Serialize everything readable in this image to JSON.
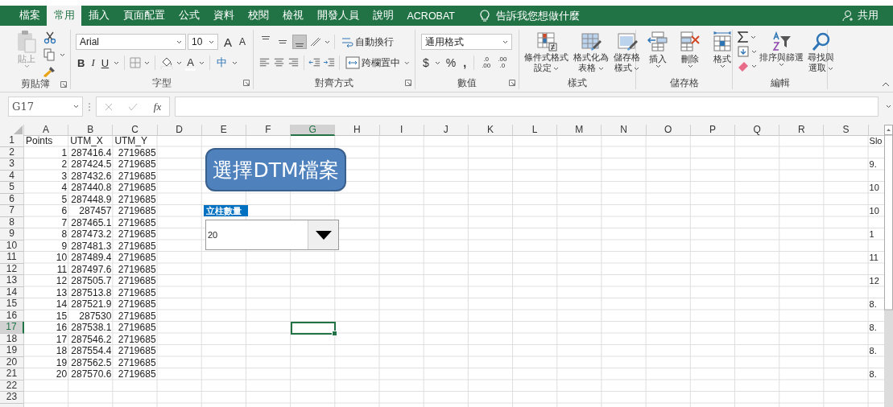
{
  "tabs": [
    {
      "label": "檔案",
      "selected": false
    },
    {
      "label": "常用",
      "selected": true
    },
    {
      "label": "插入",
      "selected": false
    },
    {
      "label": "頁面配置",
      "selected": false
    },
    {
      "label": "公式",
      "selected": false
    },
    {
      "label": "資料",
      "selected": false
    },
    {
      "label": "校閱",
      "selected": false
    },
    {
      "label": "檢視",
      "selected": false
    },
    {
      "label": "開發人員",
      "selected": false
    },
    {
      "label": "說明",
      "selected": false
    },
    {
      "label": "ACROBAT",
      "selected": false
    }
  ],
  "tell_me": {
    "placeholder": "告訴我您想做什麼"
  },
  "share": "共用",
  "clipboard": {
    "paste": {
      "label": "貼上",
      "disabled": true
    },
    "group_label": "剪貼簿"
  },
  "font": {
    "name": "Arial",
    "size": "10",
    "grow": "A",
    "shrink": "A",
    "bold": "B",
    "italic": "I",
    "underline": "U",
    "color_button": "A",
    "phonetic": "中",
    "group_label": "字型"
  },
  "alignment": {
    "vertical": [
      {
        "selected": false
      },
      {
        "selected": false
      },
      {
        "selected": true
      }
    ],
    "wrap": "自動換行",
    "merge": "跨欄置中",
    "group_label": "對齊方式"
  },
  "number": {
    "format": "通用格式",
    "currency": "$",
    "percent": "%",
    "comma": ",",
    "decimals": [
      {
        "top": ".0",
        "bottom": ".00"
      },
      {
        "top": ".00",
        "bottom": ".0"
      }
    ],
    "group_label": "數值"
  },
  "styles": {
    "buttons": [
      {
        "lines": [
          "條件式格式",
          "設定"
        ]
      },
      {
        "lines": [
          "格式化為",
          "表格"
        ]
      },
      {
        "lines": [
          "儲存格",
          "樣式"
        ]
      }
    ],
    "group_label": "樣式"
  },
  "cells": {
    "buttons": [
      "插入",
      "刪除",
      "格式"
    ],
    "group_label": "儲存格"
  },
  "editing": {
    "sort": "排序與篩選",
    "find": [
      "尋找與",
      "選取"
    ],
    "group_label": "編輯"
  },
  "formula_bar": {
    "name_box": "G17",
    "fx": "fx"
  },
  "sheet": {
    "columns": [
      {
        "label": "A",
        "selected": false
      },
      {
        "label": "B",
        "selected": false
      },
      {
        "label": "C",
        "selected": false
      },
      {
        "label": "D",
        "selected": false
      },
      {
        "label": "E",
        "selected": false
      },
      {
        "label": "F",
        "selected": false
      },
      {
        "label": "G",
        "selected": true
      },
      {
        "label": "H",
        "selected": false
      },
      {
        "label": "I",
        "selected": false
      },
      {
        "label": "J",
        "selected": false
      },
      {
        "label": "K",
        "selected": false
      },
      {
        "label": "L",
        "selected": false
      },
      {
        "label": "M",
        "selected": false
      },
      {
        "label": "N",
        "selected": false
      },
      {
        "label": "O",
        "selected": false
      },
      {
        "label": "P",
        "selected": false
      },
      {
        "label": "Q",
        "selected": false
      },
      {
        "label": "R",
        "selected": false
      },
      {
        "label": "S",
        "selected": false
      }
    ],
    "rows": [
      {
        "header": "1",
        "selected": false,
        "kind": "text",
        "cells": [
          "Points",
          "UTM_X",
          "UTM_Y"
        ],
        "column_t": "Slo"
      },
      {
        "header": "2",
        "selected": false,
        "kind": "number",
        "cells": [
          "1",
          "287416.4",
          "2719685"
        ]
      },
      {
        "header": "3",
        "selected": false,
        "kind": "number",
        "cells": [
          "2",
          "287424.5",
          "2719685"
        ],
        "column_t": "9."
      },
      {
        "header": "4",
        "selected": false,
        "kind": "number",
        "cells": [
          "3",
          "287432.6",
          "2719685"
        ]
      },
      {
        "header": "5",
        "selected": false,
        "kind": "number",
        "cells": [
          "4",
          "287440.8",
          "2719685"
        ],
        "column_t": "10"
      },
      {
        "header": "6",
        "selected": false,
        "kind": "number",
        "cells": [
          "5",
          "287448.9",
          "2719685"
        ]
      },
      {
        "header": "7",
        "selected": false,
        "kind": "number",
        "cells": [
          "6",
          "287457",
          "2719685"
        ],
        "column_t": "10"
      },
      {
        "header": "8",
        "selected": false,
        "kind": "number",
        "cells": [
          "7",
          "287465.1",
          "2719685"
        ]
      },
      {
        "header": "9",
        "selected": false,
        "kind": "number",
        "cells": [
          "8",
          "287473.2",
          "2719685"
        ],
        "column_t": "1"
      },
      {
        "header": "10",
        "selected": false,
        "kind": "number",
        "cells": [
          "9",
          "287481.3",
          "2719685"
        ]
      },
      {
        "header": "11",
        "selected": false,
        "kind": "number",
        "cells": [
          "10",
          "287489.4",
          "2719685"
        ],
        "column_t": "11"
      },
      {
        "header": "12",
        "selected": false,
        "kind": "number",
        "cells": [
          "11",
          "287497.6",
          "2719685"
        ]
      },
      {
        "header": "13",
        "selected": false,
        "kind": "number",
        "cells": [
          "12",
          "287505.7",
          "2719685"
        ],
        "column_t": "12"
      },
      {
        "header": "14",
        "selected": false,
        "kind": "number",
        "cells": [
          "13",
          "287513.8",
          "2719685"
        ]
      },
      {
        "header": "15",
        "selected": false,
        "kind": "number",
        "cells": [
          "14",
          "287521.9",
          "2719685"
        ],
        "column_t": "8."
      },
      {
        "header": "16",
        "selected": false,
        "kind": "number",
        "cells": [
          "15",
          "287530",
          "2719685"
        ]
      },
      {
        "header": "17",
        "selected": true,
        "kind": "number",
        "cells": [
          "16",
          "287538.1",
          "2719685"
        ],
        "column_t": "8."
      },
      {
        "header": "18",
        "selected": false,
        "kind": "number",
        "cells": [
          "17",
          "287546.2",
          "2719685"
        ]
      },
      {
        "header": "19",
        "selected": false,
        "kind": "number",
        "cells": [
          "18",
          "287554.4",
          "2719685"
        ],
        "column_t": "8."
      },
      {
        "header": "20",
        "selected": false,
        "kind": "number",
        "cells": [
          "19",
          "287562.5",
          "2719685"
        ]
      },
      {
        "header": "21",
        "selected": false,
        "kind": "number",
        "cells": [
          "20",
          "287570.6",
          "2719685"
        ],
        "column_t": "8."
      },
      {
        "header": "22",
        "selected": false
      },
      {
        "header": "23",
        "selected": false
      }
    ]
  },
  "shapes": {
    "button": "選擇DTM檔案",
    "label": "立柱數量",
    "combo": {
      "value": "20"
    }
  }
}
